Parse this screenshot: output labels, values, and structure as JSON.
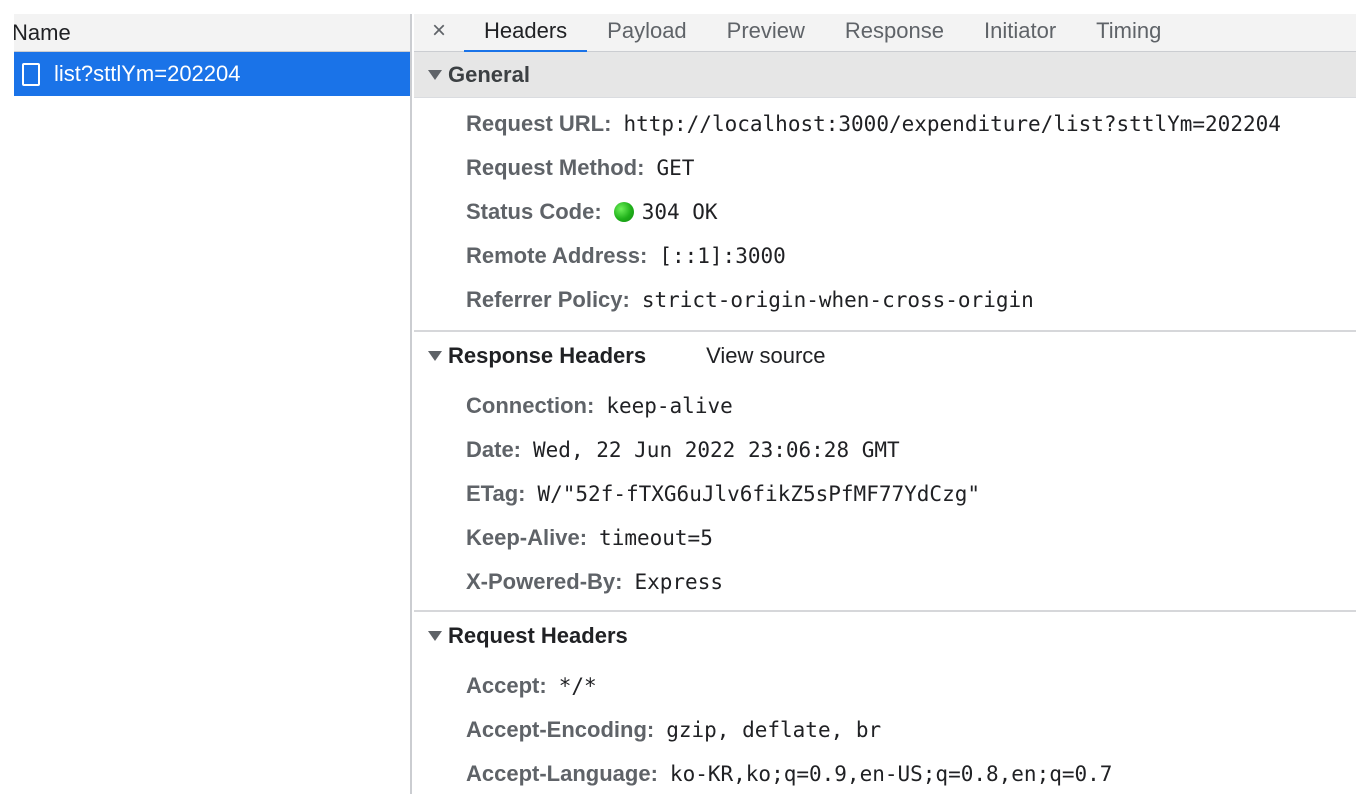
{
  "left": {
    "column_header": "Name",
    "requests": [
      {
        "name": "list?sttlYm=202204",
        "selected": true
      }
    ]
  },
  "tabs": {
    "close_symbol": "×",
    "items": [
      "Headers",
      "Payload",
      "Preview",
      "Response",
      "Initiator",
      "Timing"
    ],
    "active": "Headers"
  },
  "general": {
    "title": "General",
    "rows": [
      {
        "key": "Request URL:",
        "value": "http://localhost:3000/expenditure/list?sttlYm=202204"
      },
      {
        "key": "Request Method:",
        "value": "GET"
      },
      {
        "key": "Status Code:",
        "value": "304 OK",
        "status_color": "#1fb01a"
      },
      {
        "key": "Remote Address:",
        "value": "[::1]:3000"
      },
      {
        "key": "Referrer Policy:",
        "value": "strict-origin-when-cross-origin"
      }
    ]
  },
  "response_headers": {
    "title": "Response Headers",
    "view_source": "View source",
    "rows": [
      {
        "key": "Connection:",
        "value": "keep-alive"
      },
      {
        "key": "Date:",
        "value": "Wed, 22 Jun 2022 23:06:28 GMT"
      },
      {
        "key": "ETag:",
        "value": "W/\"52f-fTXG6uJlv6fikZ5sPfMF77YdCzg\""
      },
      {
        "key": "Keep-Alive:",
        "value": "timeout=5"
      },
      {
        "key": "X-Powered-By:",
        "value": "Express"
      }
    ]
  },
  "request_headers": {
    "title": "Request Headers",
    "rows": [
      {
        "key": "Accept:",
        "value": "*/*"
      },
      {
        "key": "Accept-Encoding:",
        "value": "gzip, deflate, br"
      },
      {
        "key": "Accept-Language:",
        "value": "ko-KR,ko;q=0.9,en-US;q=0.8,en;q=0.7"
      }
    ]
  },
  "colors": {
    "accent": "#1a73e8",
    "key_text": "#5f6368",
    "section_bg": "#e6e6e6"
  }
}
